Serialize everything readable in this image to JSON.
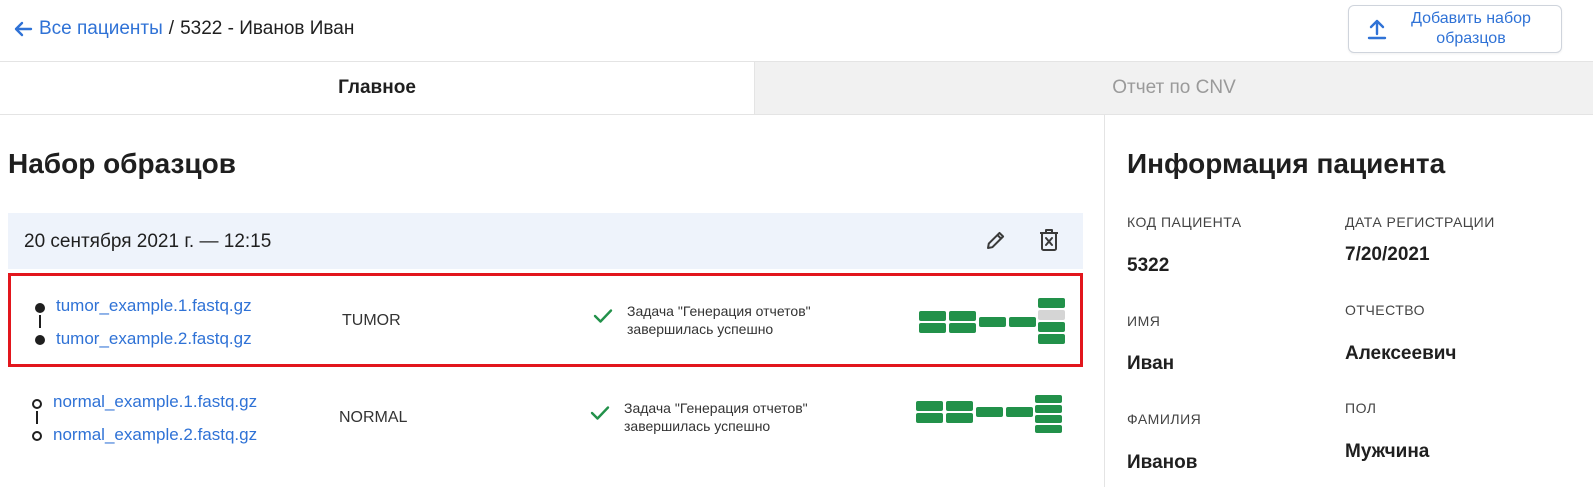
{
  "header": {
    "back_label": "Все пациенты",
    "separator": "/",
    "current_label": "5322 - Иванов Иван",
    "add_button": {
      "line1": "Добавить набор",
      "line2": "образцов"
    }
  },
  "tabs": [
    {
      "label": "Главное",
      "active": true
    },
    {
      "label": "Отчет по CNV",
      "active": false
    }
  ],
  "samples_section": {
    "title": "Набор образцов",
    "set_date": "20 сентября 2021 г. — 12:15",
    "rows": [
      {
        "file1": "tumor_example.1.fastq.gz",
        "file2": "tumor_example.2.fastq.gz",
        "type": "TUMOR",
        "status_line1": "Задача \"Генерация отчетов\"",
        "status_line2": "завершилась успешно",
        "highlighted": true
      },
      {
        "file1": "normal_example.1.fastq.gz",
        "file2": "normal_example.2.fastq.gz",
        "type": "NORMAL",
        "status_line1": "Задача \"Генерация отчетов\"",
        "status_line2": "завершилась успешно",
        "highlighted": false
      }
    ]
  },
  "patient_info": {
    "title": "Информация пациента",
    "fields": [
      {
        "label": "КОД ПАЦИЕНТА",
        "value": "5322"
      },
      {
        "label": "ДАТА РЕГИСТРАЦИИ",
        "value": "7/20/2021"
      },
      {
        "label": "ИМЯ",
        "value": "Иван"
      },
      {
        "label": "ОТЧЕСТВО",
        "value": "Алексеевич"
      },
      {
        "label": "ФАМИЛИЯ",
        "value": "Иванов"
      },
      {
        "label": "ПОЛ",
        "value": "Мужчина"
      }
    ]
  },
  "colors": {
    "link": "#2f72d6",
    "success": "#22914a",
    "highlight_border": "#e2161d",
    "set_header_bg": "#eef3fb",
    "inactive_tab_bg": "#f1f1f1"
  },
  "icons": [
    "arrow-left-icon",
    "upload-icon",
    "pencil-icon",
    "trash-icon",
    "check-icon"
  ]
}
